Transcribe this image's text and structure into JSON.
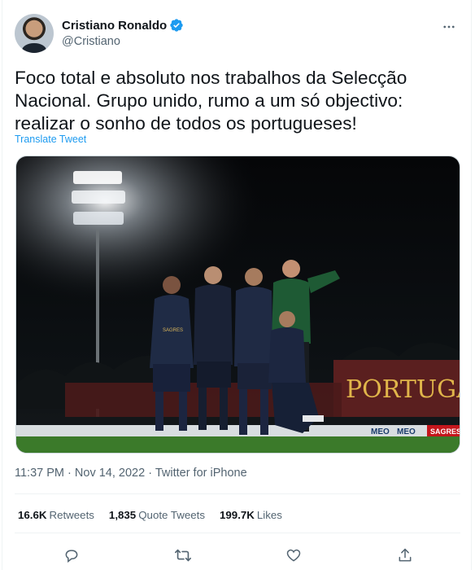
{
  "author": {
    "name": "Cristiano Ronaldo",
    "handle": "@Cristiano"
  },
  "tweet": {
    "text": "Foco total e absoluto nos trabalhos da Selecção Nacional. Grupo unido, rumo a um só objectivo: realizar o sonho de todos os portugueses!",
    "translate_label": "Translate Tweet"
  },
  "media": {
    "banner_text": "PORTUGAL",
    "sponsor_text": "SAGRES",
    "boards": [
      "MEO",
      "MEO",
      "SAGRES"
    ]
  },
  "meta": {
    "time": "11:37 PM",
    "separator": "·",
    "date": "Nov 14, 2022",
    "separator2": "·",
    "source": "Twitter for iPhone"
  },
  "stats": {
    "retweets_count": "16.6K",
    "retweets_label": "Retweets",
    "quotes_count": "1,835",
    "quotes_label": "Quote Tweets",
    "likes_count": "199.7K",
    "likes_label": "Likes"
  },
  "colors": {
    "accent": "#1d9bf0",
    "secondary_text": "#536471",
    "primary_text": "#0f1419",
    "divider": "#eff3f4"
  },
  "icons": [
    "verified-badge-icon",
    "more-icon",
    "reply-icon",
    "retweet-icon",
    "like-icon",
    "share-icon"
  ]
}
